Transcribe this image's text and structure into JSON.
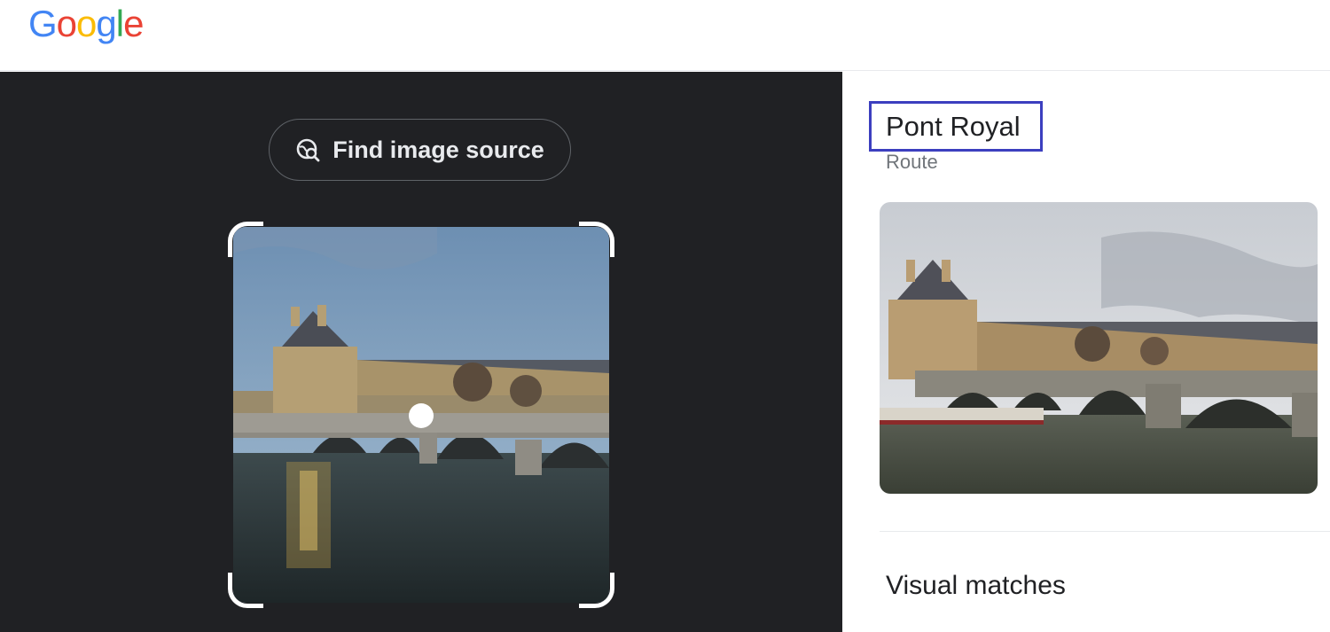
{
  "header": {
    "logo": {
      "letters": [
        {
          "char": "G",
          "color": "#4285F4"
        },
        {
          "char": "o",
          "color": "#EA4335"
        },
        {
          "char": "o",
          "color": "#FBBC05"
        },
        {
          "char": "g",
          "color": "#4285F4"
        },
        {
          "char": "l",
          "color": "#34A853"
        },
        {
          "char": "e",
          "color": "#EA4335"
        }
      ]
    }
  },
  "left_panel": {
    "find_button": {
      "label": "Find image source",
      "icon": "image-search-icon"
    },
    "crop": {
      "image": "bridge-photo",
      "handle_icon": "crop-center-handle"
    }
  },
  "right_panel": {
    "title": "Pont Royal",
    "subtitle": "Route",
    "result_image": "bridge-photo-result",
    "section_heading": "Visual matches"
  },
  "colors": {
    "left_bg": "#202124",
    "highlight_border": "#3c3fbf"
  }
}
